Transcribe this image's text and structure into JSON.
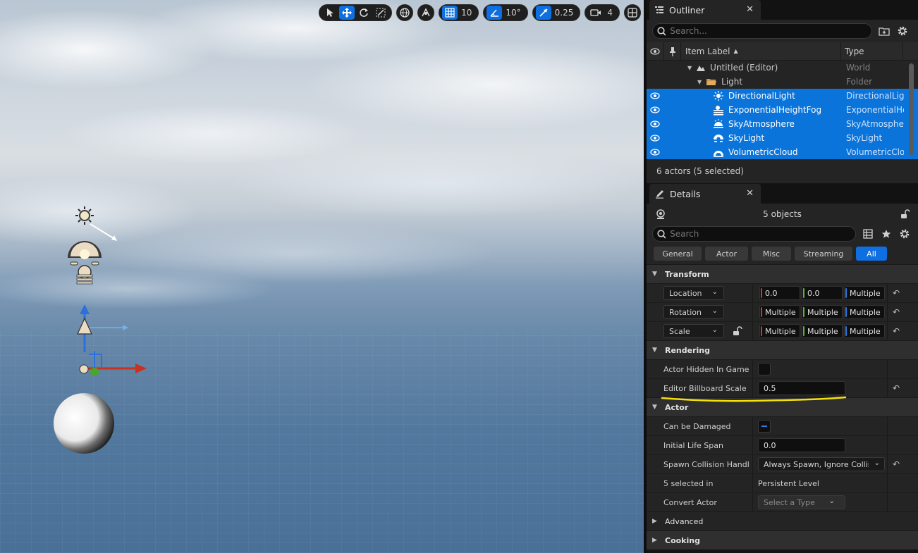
{
  "viewport": {
    "toolbar": {
      "grid_snap": "10",
      "rotation_snap": "10°",
      "scale_snap": "0.25",
      "camera_speed": "4"
    }
  },
  "outliner": {
    "tab_title": "Outliner",
    "search_placeholder": "Search...",
    "columns": {
      "label": "Item Label",
      "type": "Type"
    },
    "rows": [
      {
        "label": "Untitled (Editor)",
        "type": "World",
        "icon": "level-icon"
      },
      {
        "label": "Light",
        "type": "Folder",
        "icon": "folder-icon"
      },
      {
        "label": "DirectionalLight",
        "type": "DirectionalLight",
        "icon": "sun-icon"
      },
      {
        "label": "ExponentialHeightFog",
        "type": "ExponentialHeightFog",
        "icon": "fog-icon"
      },
      {
        "label": "SkyAtmosphere",
        "type": "SkyAtmosphere",
        "icon": "atmosphere-icon"
      },
      {
        "label": "SkyLight",
        "type": "SkyLight",
        "icon": "skylight-icon"
      },
      {
        "label": "VolumetricCloud",
        "type": "VolumetricCloud",
        "icon": "cloud-icon"
      }
    ],
    "footer": "6 actors (5 selected)"
  },
  "details": {
    "tab_title": "Details",
    "object_count": "5 objects",
    "search_placeholder": "Search",
    "filters": [
      "General",
      "Actor",
      "Misc",
      "Streaming",
      "All"
    ],
    "active_filter": "All",
    "transform": {
      "title": "Transform",
      "location": {
        "label": "Location",
        "x": "0.0",
        "y": "0.0",
        "z": "Multiple"
      },
      "rotation": {
        "label": "Rotation",
        "x": "Multiple",
        "y": "Multiple",
        "z": "Multiple"
      },
      "scale": {
        "label": "Scale",
        "x": "Multiple",
        "y": "Multiple",
        "z": "Multiple"
      }
    },
    "rendering": {
      "title": "Rendering",
      "hidden_label": "Actor Hidden In Game",
      "billboard_label": "Editor Billboard Scale",
      "billboard_value": "0.5"
    },
    "actor": {
      "title": "Actor",
      "damaged_label": "Can be Damaged",
      "lifespan_label": "Initial Life Span",
      "lifespan_value": "0.0",
      "spawn_label": "Spawn Collision Handli...",
      "spawn_value": "Always Spawn, Ignore Collisions",
      "selected_in_label": "5 selected in",
      "selected_in_value": "Persistent Level",
      "convert_label": "Convert Actor",
      "convert_placeholder": "Select a Type"
    },
    "advanced_title": "Advanced",
    "cooking_title": "Cooking"
  },
  "colors": {
    "accent": "#0e6fe0",
    "selection": "#0a74da",
    "annotation": "#f4e10a"
  }
}
